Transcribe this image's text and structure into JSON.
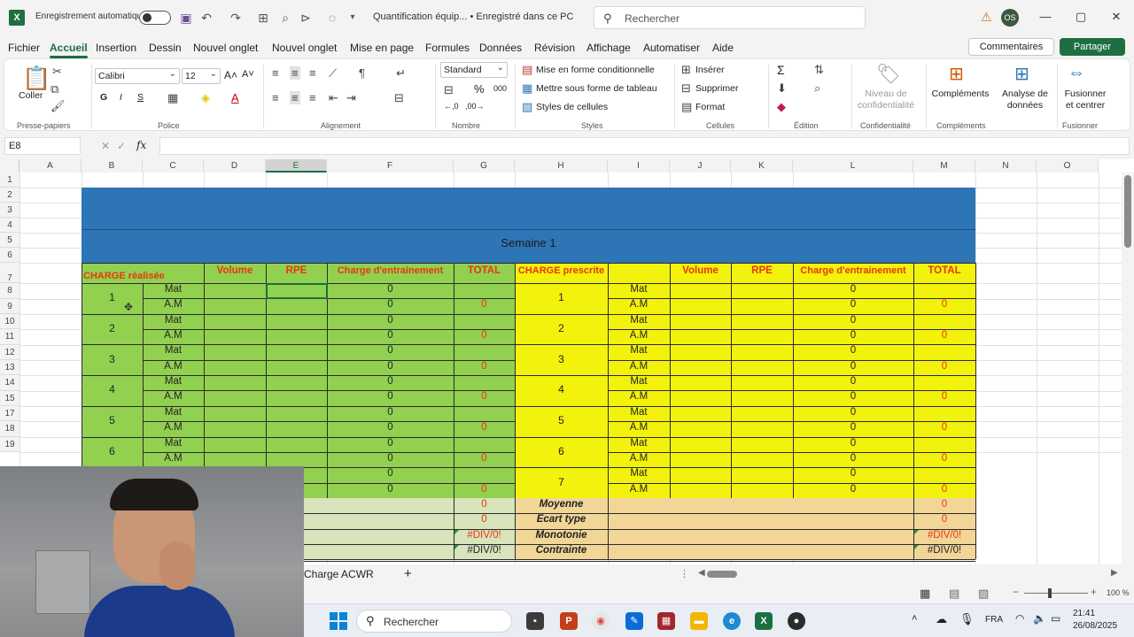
{
  "titlebar": {
    "autosave_label": "Enregistrement automatique",
    "doc_title": "Quantification équip... • Enregistré dans ce PC",
    "search_placeholder": "Rechercher",
    "avatar_initials": "OS"
  },
  "menu": {
    "items": [
      "Fichier",
      "Accueil",
      "Insertion",
      "Dessin",
      "Nouvel onglet",
      "Nouvel onglet",
      "Mise en page",
      "Formules",
      "Données",
      "Révision",
      "Affichage",
      "Automatiser",
      "Aide"
    ],
    "comments": "Commentaires",
    "share": "Partager"
  },
  "ribbon": {
    "paste": "Coller",
    "clipboard": "Presse-papiers",
    "font_name": "Calibri",
    "font_size": "12",
    "font_group": "Police",
    "alignment_group": "Alignement",
    "number_format": "Standard",
    "number_group": "Nombre",
    "cond_format": "Mise en forme conditionnelle",
    "table_format": "Mettre sous forme de tableau",
    "cell_styles": "Styles de cellules",
    "styles_group": "Styles",
    "insert": "Insérer",
    "delete": "Supprimer",
    "format": "Format",
    "cells_group": "Cellules",
    "editing_group": "Édition",
    "sensitivity_l1": "Niveau de",
    "sensitivity_l2": "confidentialité",
    "sensitivity_group": "Confidentialité",
    "addins": "Compléments",
    "addins_group": "Compléments",
    "analyze_l1": "Analyse de",
    "analyze_l2": "données",
    "merge_l1": "Fusionner",
    "merge_l2": "et centrer",
    "merge_group": "Fusionner"
  },
  "formula_bar": {
    "name_box": "E8",
    "fx": "fx",
    "content": ""
  },
  "grid": {
    "columns": [
      "A",
      "B",
      "C",
      "D",
      "E",
      "F",
      "G",
      "H",
      "I",
      "J",
      "K",
      "L",
      "M",
      "N",
      "O"
    ],
    "rows": [
      "1",
      "2",
      "3",
      "4",
      "5",
      "6",
      "7",
      "8",
      "9",
      "10",
      "11",
      "12",
      "13",
      "14",
      "15",
      "16",
      "17",
      "18",
      "19"
    ],
    "week_title": "Semaine 1",
    "realized": {
      "title": "CHARGE réalisée",
      "headers": [
        "Volume",
        "RPE",
        "Charge d'entrainement",
        "TOTAL"
      ]
    },
    "prescribed": {
      "title": "CHARGE prescrite",
      "headers": [
        "Volume",
        "RPE",
        "Charge d'entrainement",
        "TOTAL"
      ]
    },
    "session_labels": [
      "Mat",
      "A.M"
    ],
    "days": [
      "1",
      "2",
      "3",
      "4",
      "5",
      "6",
      "7"
    ],
    "zero": "0",
    "stats_labels": [
      "Moyenne",
      "Ecart type",
      "Monotonie",
      "Contrainte"
    ],
    "stats_realized": [
      "0",
      "0",
      "#DIV/0!",
      "#DIV/0!"
    ],
    "stats_prescribed": [
      "0",
      "0",
      "#DIV/0!",
      "#DIV/0!"
    ]
  },
  "sheetbar": {
    "tab": "Charge ACWR",
    "add": "+"
  },
  "statusbar": {
    "zoom": "100 %"
  },
  "taskbar": {
    "search": "Rechercher",
    "lang": "FRA",
    "time": "21:41",
    "date": "26/08/2025"
  }
}
